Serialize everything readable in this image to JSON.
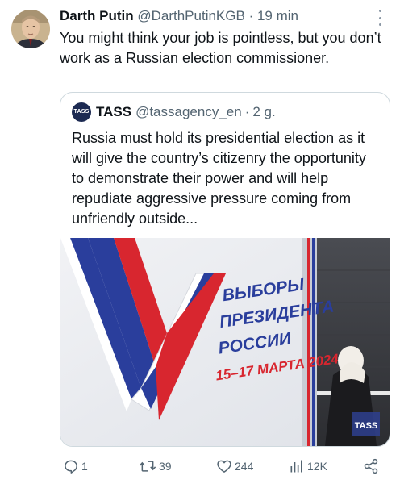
{
  "tweet": {
    "author_name": "Darth Putin",
    "author_handle": "@DarthPutinKGB",
    "separator": "·",
    "time": "19 min",
    "text": "You might think your job is pointless, but you don’t work as a Russian election commissioner."
  },
  "quote": {
    "logo_text": "TASS",
    "author_name": "TASS",
    "author_handle": "@tassagency_en",
    "separator": "·",
    "time": "2 g.",
    "text": "Russia must hold its presidential election as it will give the country’s citizenry the opportunity to demonstrate their power and will help repudiate aggressive pressure coming from unfriendly outside...",
    "image": {
      "banner_lines": [
        "ВЫБОРЫ",
        "ПРЕЗИДЕНТА",
        "РОССИИ",
        "15–17 МАРТА 2024"
      ],
      "watermark": "TASS",
      "colors": {
        "blue": "#2a3e9c",
        "red": "#d8262f",
        "background": "#e9ebef"
      }
    }
  },
  "actions": {
    "replies": "1",
    "reposts": "39",
    "likes": "244",
    "views": "12K"
  },
  "icons": [
    "more-icon",
    "reply-icon",
    "repost-icon",
    "like-icon",
    "views-icon",
    "share-icon"
  ],
  "colors": {
    "text": "#0f1419",
    "muted": "#536471",
    "border": "#cfd9de"
  }
}
